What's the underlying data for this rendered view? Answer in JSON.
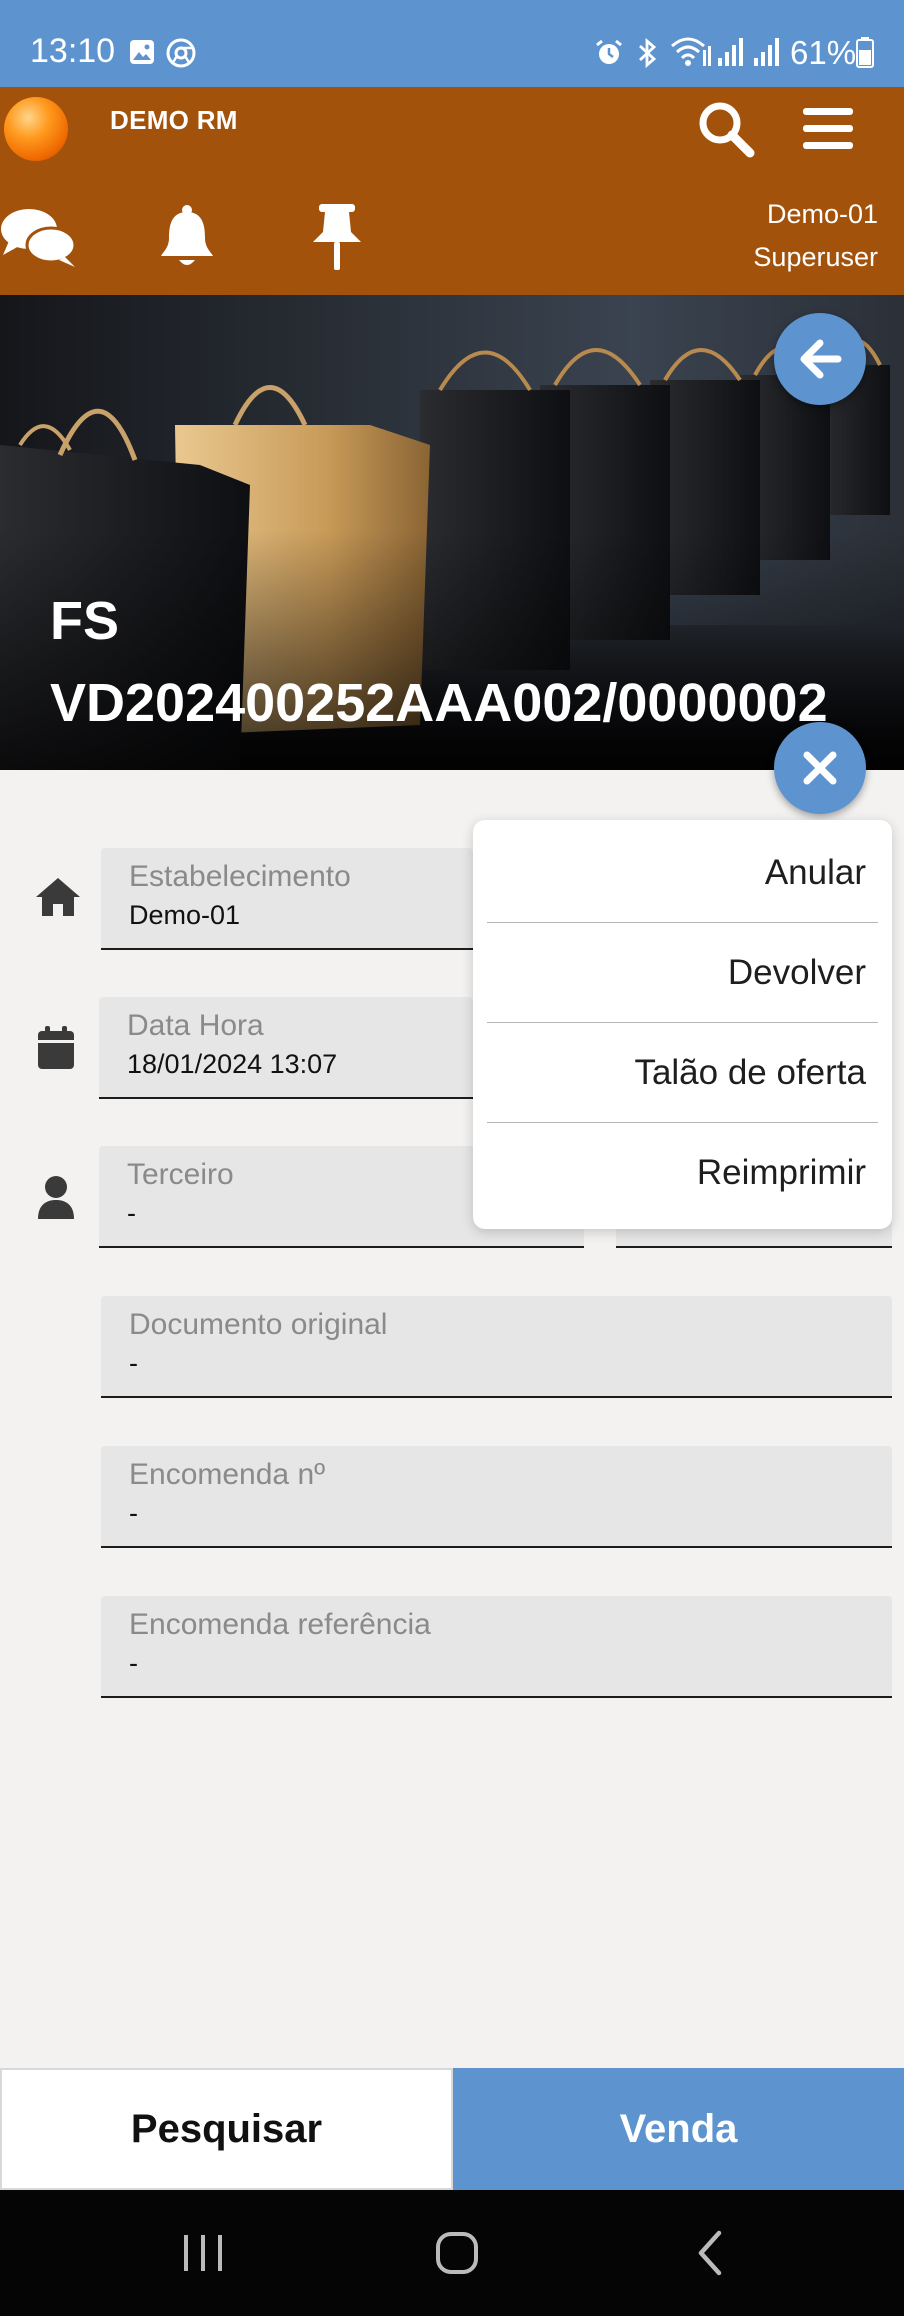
{
  "status_bar": {
    "time": "13:10",
    "battery": "61%",
    "icons": [
      "gallery-icon",
      "chrome-icon",
      "alarm-icon",
      "bluetooth-icon",
      "wifi-icon",
      "signal-icon",
      "signal-icon",
      "battery-icon"
    ]
  },
  "app": {
    "title": "DEMO RM",
    "user_line1": "Demo-01",
    "user_line2": "Superuser",
    "colors": {
      "header": "#a2520b",
      "accent": "#5d94cf"
    }
  },
  "hero": {
    "title_line1": "FS",
    "title_line2": "VD202400252AAA002/0000002"
  },
  "form": {
    "estabelecimento": {
      "label": "Estabelecimento",
      "value": "Demo-01"
    },
    "data_hora": {
      "label": "Data Hora",
      "value": "18/01/2024 13:07"
    },
    "terceiro": {
      "label": "Terceiro",
      "value": "-"
    },
    "documento_original": {
      "label": "Documento original",
      "value": "-"
    },
    "encomenda_n": {
      "label": "Encomenda nº",
      "value": "-"
    },
    "encomenda_referencia": {
      "label": "Encomenda referência",
      "value": "-"
    }
  },
  "menu": {
    "items": [
      "Anular",
      "Devolver",
      "Talão de oferta",
      "Reimprimir"
    ]
  },
  "bottom": {
    "search_label": "Pesquisar",
    "sale_label": "Venda"
  }
}
